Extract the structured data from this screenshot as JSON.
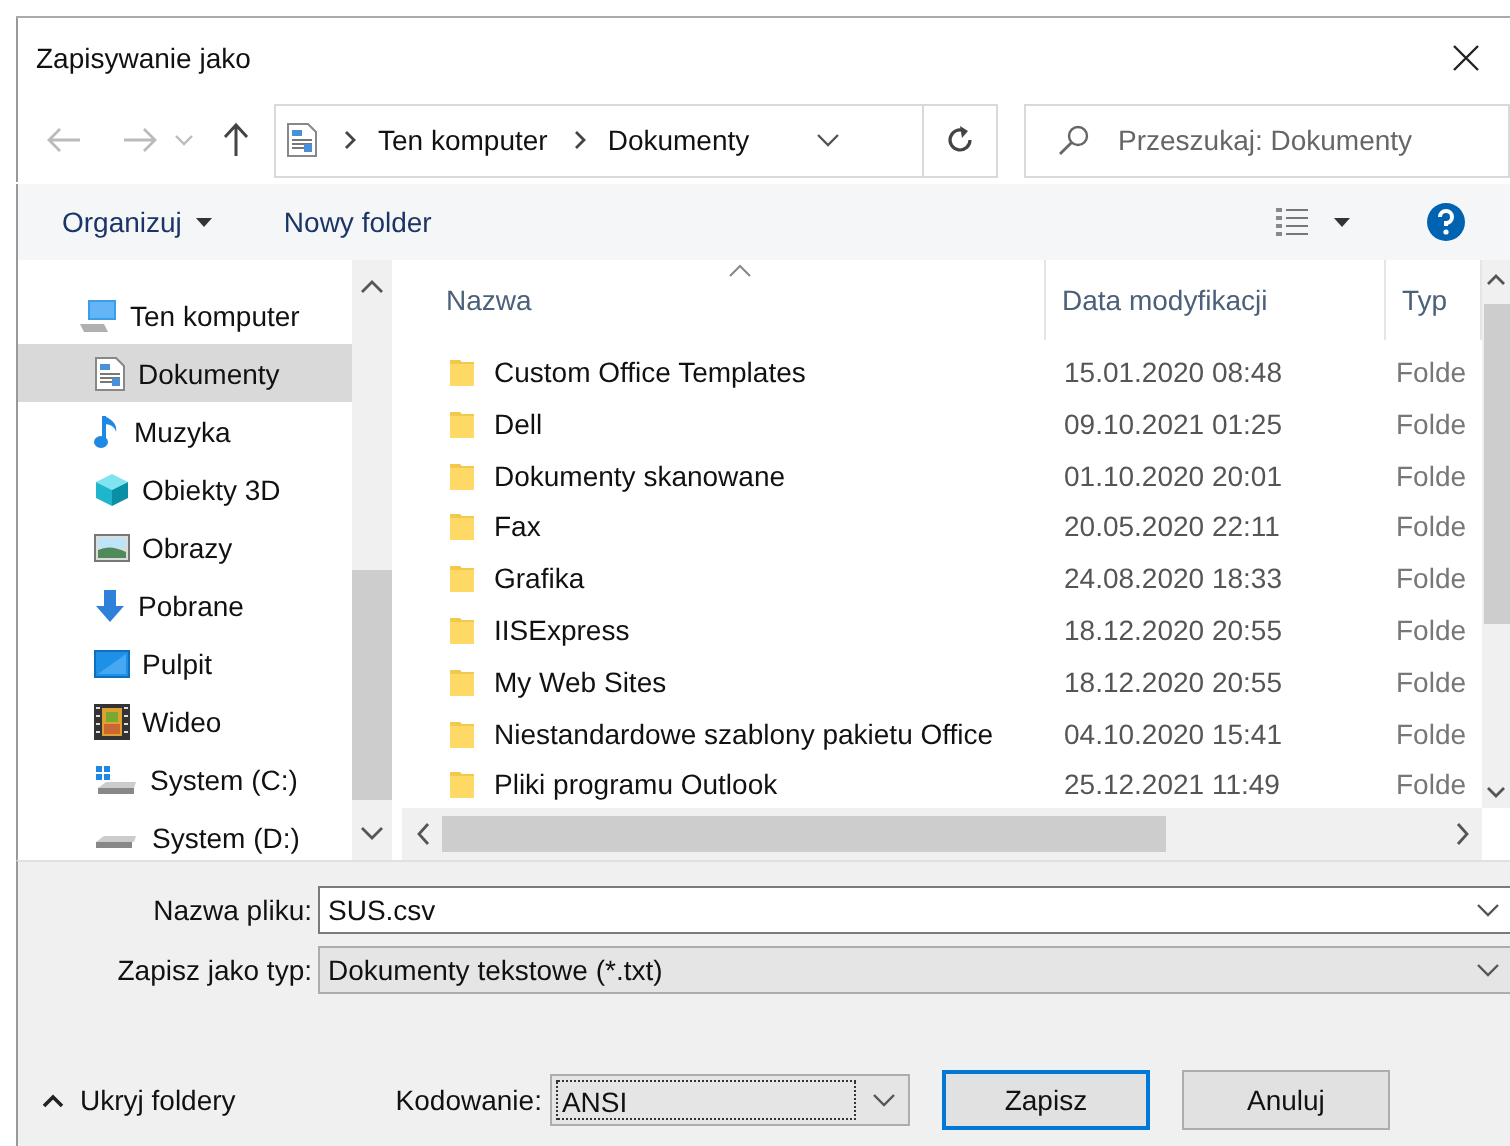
{
  "window": {
    "title": "Zapisywanie jako"
  },
  "navigation": {
    "breadcrumb": [
      "Ten komputer",
      "Dokumenty"
    ],
    "search": {
      "placeholder": "Przeszukaj: Dokumenty"
    }
  },
  "toolbar": {
    "organize": "Organizuj",
    "new_folder": "Nowy folder"
  },
  "sidebar": {
    "items": [
      {
        "label": "Ten komputer",
        "kind": "computer",
        "selected": false,
        "children": [
          {
            "label": "Dokumenty",
            "kind": "documents",
            "selected": true
          },
          {
            "label": "Muzyka",
            "kind": "music",
            "selected": false
          },
          {
            "label": "Obiekty 3D",
            "kind": "cube",
            "selected": false
          },
          {
            "label": "Obrazy",
            "kind": "pictures",
            "selected": false
          },
          {
            "label": "Pobrane",
            "kind": "downloads",
            "selected": false
          },
          {
            "label": "Pulpit",
            "kind": "desktop",
            "selected": false
          },
          {
            "label": "Wideo",
            "kind": "video",
            "selected": false
          },
          {
            "label": "System (C:)",
            "kind": "system-drive",
            "selected": false
          },
          {
            "label": "System (D:)",
            "kind": "drive",
            "selected": false
          }
        ]
      }
    ]
  },
  "table": {
    "columns": [
      "Nazwa",
      "Data modyfikacji",
      "Typ"
    ],
    "rows": [
      {
        "name": "Custom Office Templates",
        "modified": "15.01.2020 08:48",
        "type": "Folde"
      },
      {
        "name": "Dell",
        "modified": "09.10.2021 01:25",
        "type": "Folde"
      },
      {
        "name": "Dokumenty skanowane",
        "modified": "01.10.2020 20:01",
        "type": "Folde"
      },
      {
        "name": "Fax",
        "modified": "20.05.2020 22:11",
        "type": "Folde"
      },
      {
        "name": "Grafika",
        "modified": "24.08.2020 18:33",
        "type": "Folde"
      },
      {
        "name": "IISExpress",
        "modified": "18.12.2020 20:55",
        "type": "Folde"
      },
      {
        "name": "My Web Sites",
        "modified": "18.12.2020 20:55",
        "type": "Folde"
      },
      {
        "name": "Niestandardowe szablony pakietu Office",
        "modified": "04.10.2020 15:41",
        "type": "Folde"
      },
      {
        "name": "Pliki programu Outlook",
        "modified": "25.12.2021 11:49",
        "type": "Folde"
      }
    ]
  },
  "form": {
    "file_name": {
      "label": "Nazwa pliku:",
      "value": "SUS.csv"
    },
    "file_type": {
      "label": "Zapisz jako typ:",
      "value": "Dokumenty tekstowe (*.txt)"
    },
    "hide_folders": "Ukryj foldery",
    "encoding": {
      "label": "Kodowanie:",
      "value": "ANSI"
    },
    "buttons": [
      {
        "label": "Zapisz",
        "default": true
      },
      {
        "label": "Anuluj",
        "default": false
      }
    ]
  }
}
